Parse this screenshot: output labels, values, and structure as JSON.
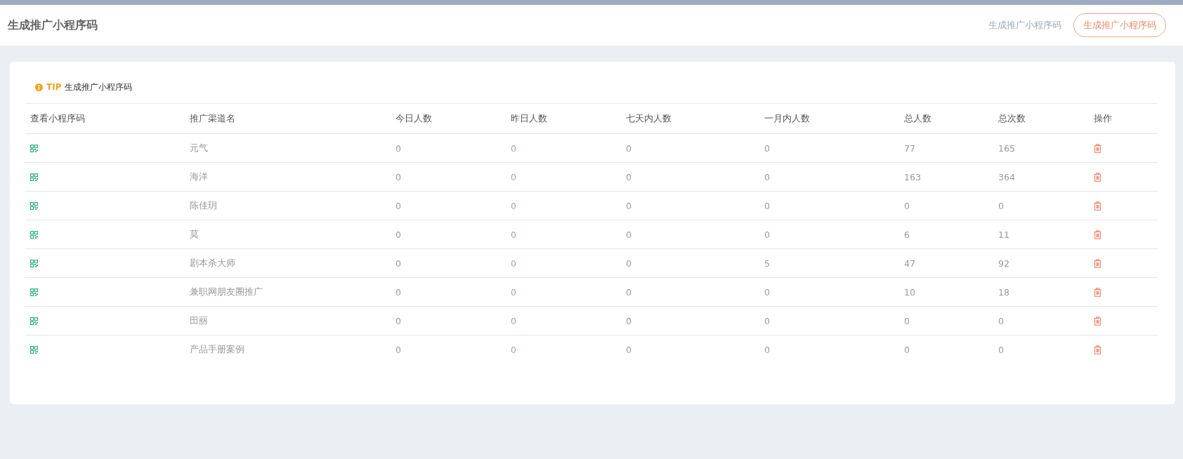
{
  "header": {
    "title": "生成推广小程序码",
    "link": "生成推广小程序码",
    "button": "生成推广小程序码"
  },
  "tip": {
    "label": "TIP",
    "text": "生成推广小程序码"
  },
  "table": {
    "columns": [
      "查看小程序码",
      "推广渠道名",
      "今日人数",
      "昨日人数",
      "七天内人数",
      "一月内人数",
      "总人数",
      "总次数",
      "操作"
    ],
    "rows": [
      {
        "name": "元气",
        "today": "0",
        "yesterday": "0",
        "week": "0",
        "month": "0",
        "total_people": "77",
        "total_times": "165"
      },
      {
        "name": "海洋",
        "today": "0",
        "yesterday": "0",
        "week": "0",
        "month": "0",
        "total_people": "163",
        "total_times": "364"
      },
      {
        "name": "陈佳玥",
        "today": "0",
        "yesterday": "0",
        "week": "0",
        "month": "0",
        "total_people": "0",
        "total_times": "0"
      },
      {
        "name": "莫",
        "today": "0",
        "yesterday": "0",
        "week": "0",
        "month": "0",
        "total_people": "6",
        "total_times": "11"
      },
      {
        "name": "剧本杀大师",
        "today": "0",
        "yesterday": "0",
        "week": "0",
        "month": "5",
        "total_people": "47",
        "total_times": "92"
      },
      {
        "name": "兼职网朋友圈推广",
        "today": "0",
        "yesterday": "0",
        "week": "0",
        "month": "0",
        "total_people": "10",
        "total_times": "18"
      },
      {
        "name": "田丽",
        "today": "0",
        "yesterday": "0",
        "week": "0",
        "month": "0",
        "total_people": "0",
        "total_times": "0"
      },
      {
        "name": "产品手册案例",
        "today": "0",
        "yesterday": "0",
        "week": "0",
        "month": "0",
        "total_people": "0",
        "total_times": "0"
      }
    ]
  }
}
